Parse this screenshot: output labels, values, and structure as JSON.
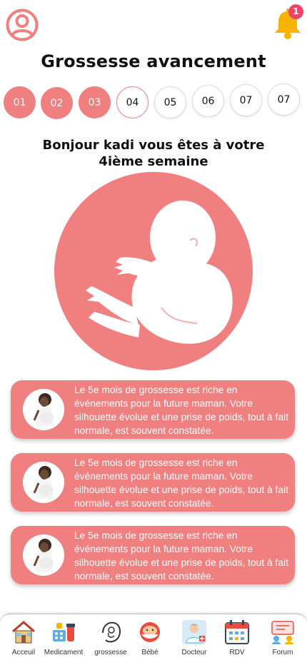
{
  "header": {
    "notification_count": "1",
    "profile_icon": "user-circle-icon",
    "bell_icon": "bell-icon"
  },
  "page_title": "Grossesse avancement",
  "steps": [
    {
      "label": "01",
      "state": "done"
    },
    {
      "label": "02",
      "state": "done"
    },
    {
      "label": "03",
      "state": "done"
    },
    {
      "label": "04",
      "state": "current"
    },
    {
      "label": "05",
      "state": "todo"
    },
    {
      "label": "06",
      "state": "todo"
    },
    {
      "label": "07",
      "state": "todo"
    },
    {
      "label": "07",
      "state": "todo"
    }
  ],
  "greeting": "Bonjour kadi vous êtes à votre 4ième semaine",
  "cards": [
    {
      "text": "Le 5e mois de grossesse est riche en événements pour la future maman. Votre silhouette évolue et une prise de poids, tout à fait normale, est souvent constatée."
    },
    {
      "text": "Le 5e mois de grossesse est riche en événements pour la future maman. Votre silhouette évolue et une prise de poids, tout à fait normale, est souvent constatée."
    },
    {
      "text": "Le 5e mois de grossesse est riche en événements pour la future maman. Votre silhouette évolue et une prise de poids, tout à fait normale, est souvent constatée."
    }
  ],
  "nav": [
    {
      "label": "Acceuil",
      "icon": "house-icon"
    },
    {
      "label": "Medicament",
      "icon": "medicine-icon"
    },
    {
      "label": "grossesse",
      "icon": "pregnancy-icon"
    },
    {
      "label": "Bébé",
      "icon": "baby-icon"
    },
    {
      "label": "Docteur",
      "icon": "doctor-icon"
    },
    {
      "label": "RDV",
      "icon": "calendar-icon"
    },
    {
      "label": "Forum",
      "icon": "forum-icon"
    }
  ],
  "colors": {
    "accent": "#f08080",
    "badge": "#ee4466",
    "bell": "#f5b400"
  }
}
